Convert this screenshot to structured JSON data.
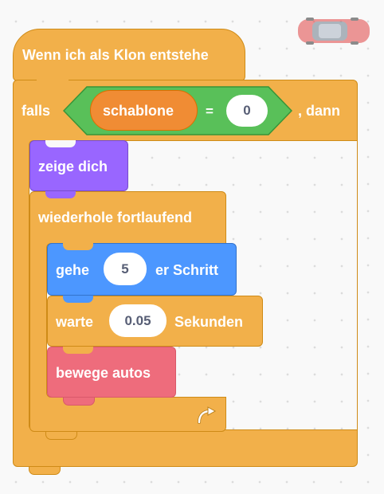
{
  "hat": {
    "label": "Wenn ich als Klon entstehe"
  },
  "if_block": {
    "keyword": "falls",
    "then": ", dann"
  },
  "condition": {
    "variable": "schablone",
    "operator": "=",
    "value": "0"
  },
  "show_block": {
    "label": "zeige dich"
  },
  "forever_block": {
    "label": "wiederhole fortlaufend"
  },
  "move_block": {
    "prefix": "gehe",
    "steps": "5",
    "suffix": "er Schritt"
  },
  "wait_block": {
    "prefix": "warte",
    "seconds": "0.05",
    "suffix": "Sekunden"
  },
  "custom_block": {
    "label": "bewege autos"
  },
  "sprite": {
    "icon": "red-car-icon"
  },
  "colors": {
    "events": "#f2b04a",
    "looks": "#9966ff",
    "motion": "#4c97ff",
    "operators": "#59c059",
    "variable_reporter": "#f08c34",
    "custom": "#ee6c7c"
  }
}
